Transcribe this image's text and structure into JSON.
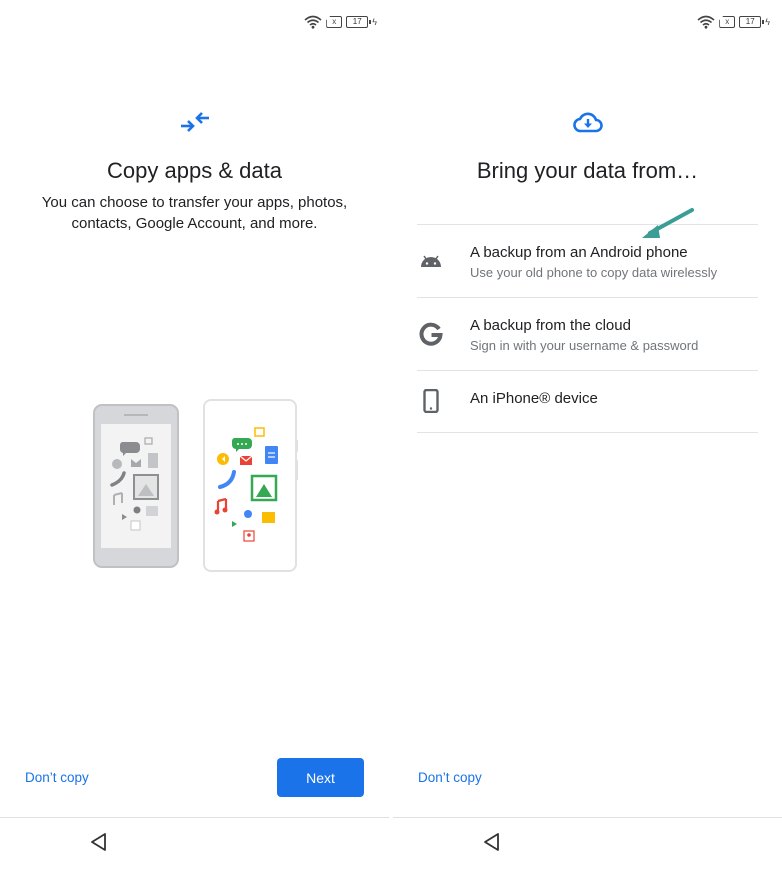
{
  "statusbar": {
    "icons": [
      "wifi-icon",
      "no-sim-icon",
      "battery-icon",
      "charging-icon"
    ],
    "sim_label": "x",
    "battery_level": "17",
    "charging_glyph": "ϟ"
  },
  "screens": {
    "left": {
      "hero_icon": "transfer-arrows-icon",
      "title": "Copy apps & data",
      "subtitle": "You can choose to transfer your apps, photos, contacts, Google Account, and more.",
      "illustration": "old-phone-to-new-phone-illustration",
      "dont_copy_label": "Don’t copy",
      "next_label": "Next",
      "nav_back_icon": "back-triangle-icon"
    },
    "right": {
      "hero_icon": "cloud-download-icon",
      "title": "Bring your data from…",
      "options": [
        {
          "icon": "android-icon",
          "title": "A backup from an Android phone",
          "description": "Use your old phone to copy data wirelessly"
        },
        {
          "icon": "google-g-icon",
          "title": "A backup from the cloud",
          "description": "Sign in with your username & password"
        },
        {
          "icon": "smartphone-icon",
          "title": "An iPhone® device",
          "description": ""
        }
      ],
      "annotation": "teal-arrow-pointing-to-android-option",
      "dont_copy_label": "Don’t copy",
      "nav_back_icon": "back-triangle-icon"
    }
  },
  "colors": {
    "accent": "#1a73e8",
    "annotation_arrow": "#3a9e96",
    "icon_gray": "#5f6368"
  }
}
